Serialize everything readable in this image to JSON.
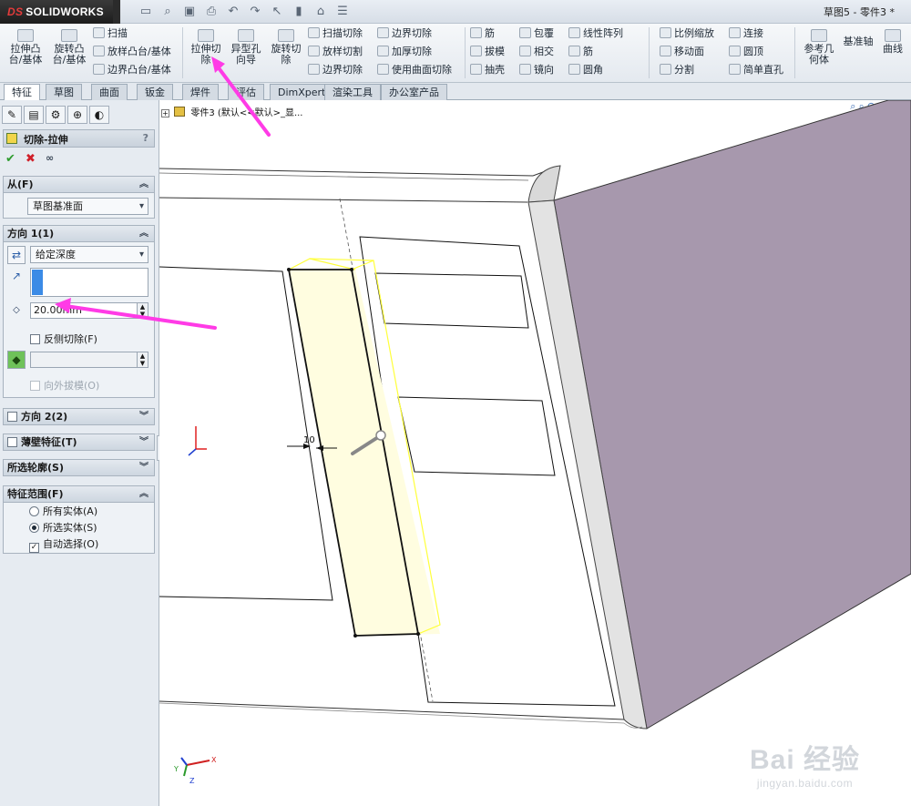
{
  "app": {
    "brand": "SOLIDWORKS",
    "brand_mark": "DS",
    "document_title": "草图5 - 零件3 *"
  },
  "quick_access": {
    "icons": [
      "new-icon",
      "open-icon",
      "save-icon",
      "print-icon",
      "undo-icon",
      "redo-icon",
      "select-icon",
      "rebuild-icon",
      "file-props-icon",
      "options-icon"
    ]
  },
  "command_manager": {
    "extrude_boss": "拉伸凸\n台/基体",
    "revolve_boss": "旋转凸\n台/基体",
    "sweep": "扫描",
    "loft_boss": "放样凸台/基体",
    "boundary_boss": "边界凸台/基体",
    "extrude_cut": "拉伸切\n除",
    "hole_wizard": "异型孔\n向导",
    "revolve_cut": "旋转切\n除",
    "swept_cut": "扫描切除",
    "lofted_cut": "放样切割",
    "boundary_cut": "边界切除",
    "boundary_cut2": "边界切除",
    "thicken_cut": "加厚切除",
    "surface_cut": "使用曲面切除",
    "rib": "筋",
    "draft": "拔模",
    "shell": "抽壳",
    "wrap": "包覆",
    "intersect": "相交",
    "mirror": "镜向",
    "linear_pattern": "线性阵列",
    "rib2": "筋",
    "fillet": "圆角",
    "scale": "比例缩放",
    "move_face": "移动面",
    "split": "分割",
    "connect": "连接",
    "dome": "圆顶",
    "simple_hole": "简单直孔",
    "ref_geometry": "参考几\n何体",
    "ref_axis": "基准轴",
    "curves": "曲线"
  },
  "tabs": [
    "特征",
    "草图",
    "曲面",
    "钣金",
    "焊件",
    "评估",
    "DimXpert",
    "渲染工具",
    "办公室产品"
  ],
  "property_manager": {
    "panel_tabs": [
      "feature-manager-icon",
      "property-manager-icon",
      "configuration-icon",
      "dimxpert-icon",
      "display-manager-icon"
    ],
    "title": "切除-拉伸",
    "help": "?",
    "from": {
      "header": "从(F)",
      "value": "草图基准面"
    },
    "direction1": {
      "header": "方向 1(1)",
      "end_condition": "给定深度",
      "depth": "20.00mm",
      "flip_side": "反侧切除(F)",
      "draft_outward": "向外拔模(O)"
    },
    "direction2": {
      "header": "方向 2(2)"
    },
    "thin_feature": {
      "header": "薄壁特征(T)"
    },
    "selected_contours": {
      "header": "所选轮廓(S)"
    },
    "feature_scope": {
      "header": "特征范围(F)",
      "all_bodies": "所有实体(A)",
      "selected_bodies": "所选实体(S)",
      "selected_checked": true,
      "auto_select": "自动选择(O)",
      "auto_select_checked": true
    }
  },
  "viewport": {
    "tree_label": "零件3 (默认<<默认>_显...",
    "dimension_value": "10",
    "watermark_brand": "Bai 经验",
    "watermark_url": "jingyan.baidu.com"
  },
  "colors": {
    "annotation_arrow": "#ff3be6",
    "preview_yellow": "#ffff3b",
    "body_face": "#a798ad",
    "accent_blue": "#3b78d6"
  }
}
